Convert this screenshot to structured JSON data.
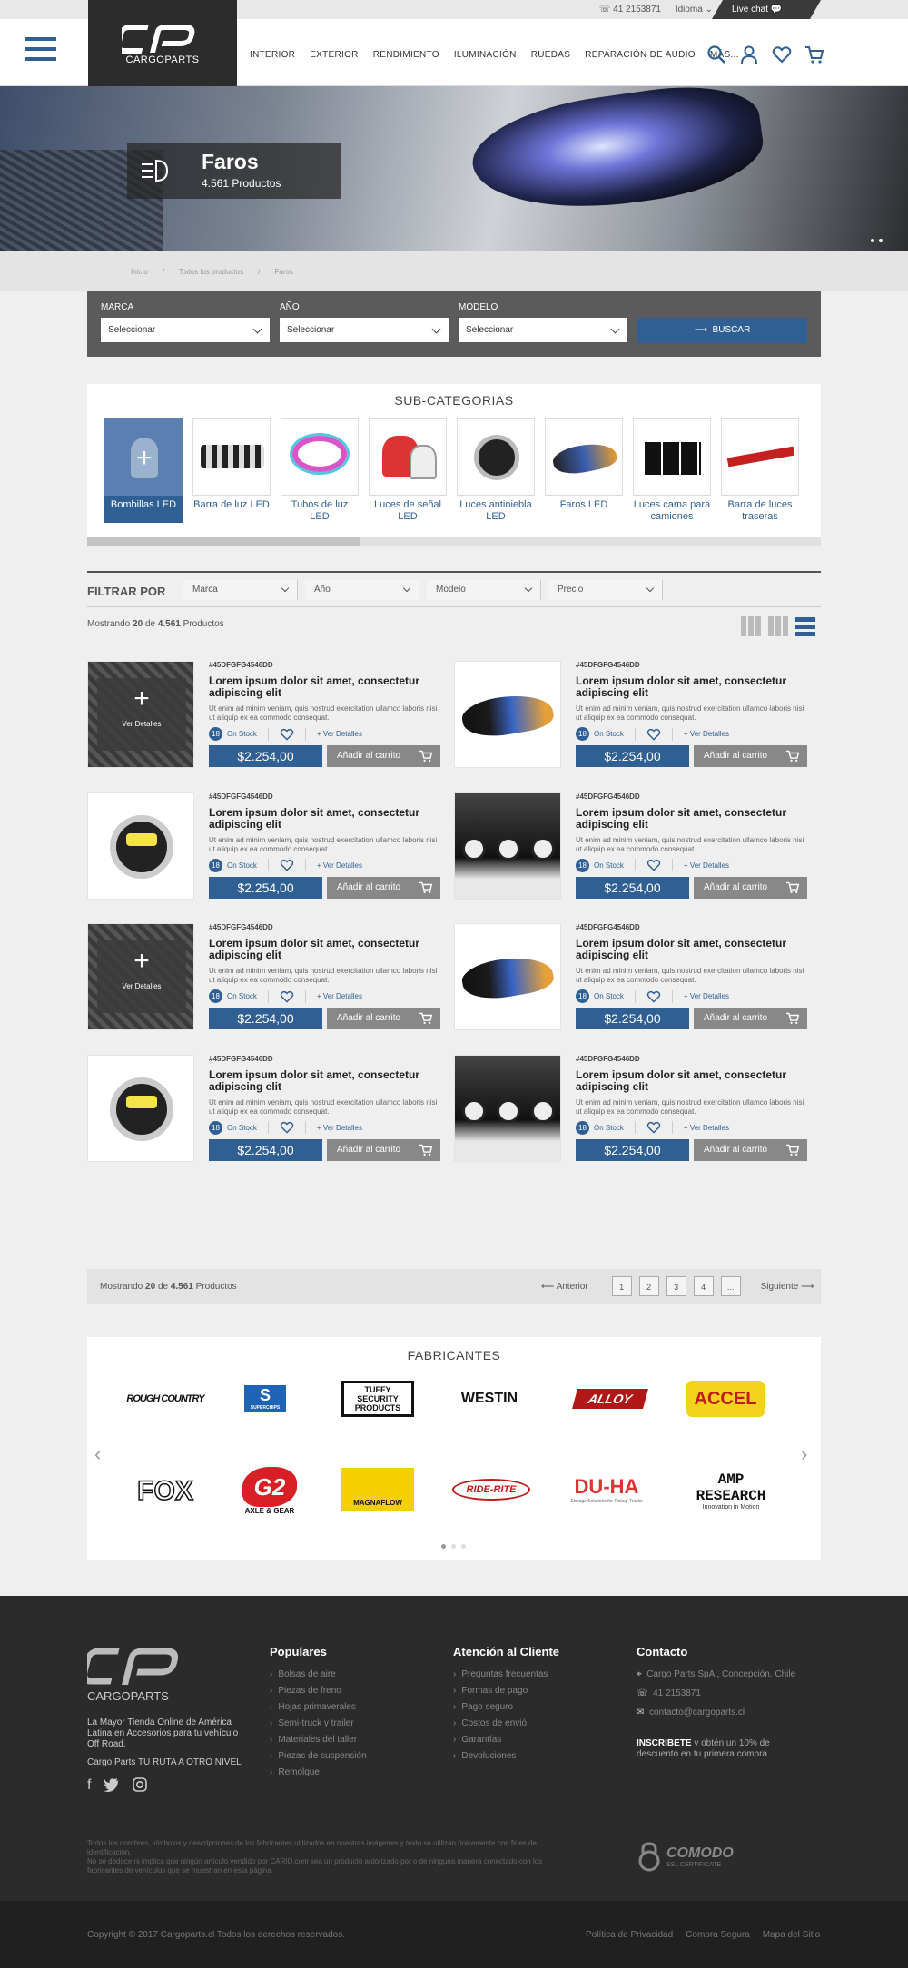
{
  "topbar": {
    "phone": "41 2153871",
    "language": "Idioma",
    "livechat": "Live chat"
  },
  "brand": {
    "name": "CARGOPARTS",
    "mark": "CP"
  },
  "nav": [
    "INTERIOR",
    "EXTERIOR",
    "RENDIMIENTO",
    "ILUMINACIÓN",
    "RUEDAS",
    "REPARACIÓN DE AUDIO",
    "MÁS..."
  ],
  "hero": {
    "title": "Faros",
    "count": "4.561 Productos"
  },
  "breadcrumb": [
    "Inicio",
    "Todos los productos",
    "Faros"
  ],
  "search": {
    "fields": [
      {
        "label": "MARCA",
        "value": "Seleccionar"
      },
      {
        "label": "AÑO",
        "value": "Seleccionar"
      },
      {
        "label": "MODELO",
        "value": "Seleccionar"
      }
    ],
    "button": "BUSCAR"
  },
  "subcategories": {
    "title": "SUB-CATEGORIAS",
    "items": [
      "Bombillas LED",
      "Barra de luz LED",
      "Tubos de luz LED",
      "Luces de señal LED",
      "Luces antiniebla LED",
      "Faros LED",
      "Luces cama para camiones",
      "Barra de luces traseras"
    ]
  },
  "filter": {
    "title": "FILTRAR POR",
    "options": [
      "Marca",
      "Año",
      "Modelo",
      "Precio"
    ]
  },
  "showing": {
    "prefix": "Mostrando",
    "shown": "20",
    "of": "de",
    "total": "4.561",
    "suffix": "Productos"
  },
  "products": [
    {
      "sku": "#45DFGFG4546DD",
      "title": "Lorem ipsum dolor sit amet, consectetur adipiscing elit",
      "desc": "Ut enim ad minim veniam, quis nostrud exercitation ullamco laboris nisi ut aliquip ex ea commodo consequat.",
      "stock_count": "18",
      "stock": "On Stock",
      "details": "Ver Detalles",
      "price": "$2.254,00",
      "cart": "Añadir al carrito",
      "overlay": "Ver Detalles",
      "img": "grille"
    },
    {
      "sku": "#45DFGFG4546DD",
      "title": "Lorem ipsum dolor sit amet, consectetur adipiscing elit",
      "desc": "Ut enim ad minim veniam, quis nostrud exercitation ullamco laboris nisi ut aliquip ex ea commodo consequat.",
      "stock_count": "18",
      "stock": "On Stock",
      "details": "Ver Detalles",
      "price": "$2.254,00",
      "cart": "Añadir al carrito",
      "overlay": "",
      "img": "headlight"
    },
    {
      "sku": "#45DFGFG4546DD",
      "title": "Lorem ipsum dolor sit amet, consectetur adipiscing elit",
      "desc": "Ut enim ad minim veniam, quis nostrud exercitation ullamco laboris nisi ut aliquip ex ea commodo consequat.",
      "stock_count": "18",
      "stock": "On Stock",
      "details": "Ver Detalles",
      "price": "$2.254,00",
      "cart": "Añadir al carrito",
      "overlay": "",
      "img": "foglight"
    },
    {
      "sku": "#45DFGFG4546DD",
      "title": "Lorem ipsum dolor sit amet, consectetur adipiscing elit",
      "desc": "Ut enim ad minim veniam, quis nostrud exercitation ullamco laboris nisi ut aliquip ex ea commodo consequat.",
      "stock_count": "18",
      "stock": "On Stock",
      "details": "Ver Detalles",
      "price": "$2.254,00",
      "cart": "Añadir al carrito",
      "overlay": "",
      "img": "jeep"
    },
    {
      "sku": "#45DFGFG4546DD",
      "title": "Lorem ipsum dolor sit amet, consectetur adipiscing elit",
      "desc": "Ut enim ad minim veniam, quis nostrud exercitation ullamco laboris nisi ut aliquip ex ea commodo consequat.",
      "stock_count": "18",
      "stock": "On Stock",
      "details": "Ver Detalles",
      "price": "$2.254,00",
      "cart": "Añadir al carrito",
      "overlay": "Ver Detalles",
      "img": "grille"
    },
    {
      "sku": "#45DFGFG4546DD",
      "title": "Lorem ipsum dolor sit amet, consectetur adipiscing elit",
      "desc": "Ut enim ad minim veniam, quis nostrud exercitation ullamco laboris nisi ut aliquip ex ea commodo consequat.",
      "stock_count": "18",
      "stock": "On Stock",
      "details": "Ver Detalles",
      "price": "$2.254,00",
      "cart": "Añadir al carrito",
      "overlay": "",
      "img": "headlight"
    },
    {
      "sku": "#45DFGFG4546DD",
      "title": "Lorem ipsum dolor sit amet, consectetur adipiscing elit",
      "desc": "Ut enim ad minim veniam, quis nostrud exercitation ullamco laboris nisi ut aliquip ex ea commodo consequat.",
      "stock_count": "18",
      "stock": "On Stock",
      "details": "Ver Detalles",
      "price": "$2.254,00",
      "cart": "Añadir al carrito",
      "overlay": "",
      "img": "foglight"
    },
    {
      "sku": "#45DFGFG4546DD",
      "title": "Lorem ipsum dolor sit amet, consectetur adipiscing elit",
      "desc": "Ut enim ad minim veniam, quis nostrud exercitation ullamco laboris nisi ut aliquip ex ea commodo consequat.",
      "stock_count": "18",
      "stock": "On Stock",
      "details": "Ver Detalles",
      "price": "$2.254,00",
      "cart": "Añadir al carrito",
      "overlay": "",
      "img": "jeep"
    }
  ],
  "pager": {
    "prev": "Anterior",
    "pages": [
      "1",
      "2",
      "3",
      "4",
      "..."
    ],
    "next": "Siguiente"
  },
  "manufacturers": {
    "title": "FABRICANTES",
    "brands": [
      "ROUGH COUNTRY",
      "SUPERCHIPS",
      "TUFFY SECURITY PRODUCTS",
      "WESTIN",
      "ALLOY",
      "ACCEL",
      "FOX",
      "G2 AXLE & GEAR",
      "MAGNAFLOW",
      "RIDE-RITE",
      "DU-HA",
      "AMP RESEARCH"
    ],
    "brand_sublines": {
      "superchips": "SUPERCHIPS",
      "g2": "AXLE & GEAR",
      "duha": "Storage Solutions for Pickup Trucks",
      "amp": "Innovation in Motion"
    }
  },
  "footer": {
    "tagline": "La Mayor Tienda Online de América Latina en Accesorios para tu vehículo Off Road.",
    "slogan": "Cargo Parts TU RUTA A OTRO NIVEL",
    "col1": {
      "title": "Populares",
      "items": [
        "Bolsas de aire",
        "Piezas de freno",
        "Hojas primaverales",
        "Semi-truck y trailer",
        "Materiales del taller",
        "Piezas de suspensión",
        "Remolque"
      ]
    },
    "col2": {
      "title": "Atención al Cliente",
      "items": [
        "Preguntas frecuentas",
        "Formas de pago",
        "Pago seguro",
        "Costos de envió",
        "Garantías",
        "Devoluciones"
      ]
    },
    "contact": {
      "title": "Contacto",
      "address": "Cargo Parts SpA , Concepción. Chile",
      "phone": "41 2153871",
      "email": "contacto@cargoparts.cl",
      "subscribe_bold": "INSCRIBETE",
      "subscribe_text": " y obtén un 10% de descuento en tu primera compra."
    },
    "legal1": "Todos los nombres, símbolos y descripciones de los fabricantes utilizados en nuestras imágenes y texto se utilizan únicamente con fines de identificación.",
    "legal2": "No se deduce ni implica que ningún artículo vendido por CARID.com sea un producto autorizado por o de ninguna manera conectado con los fabricantes de vehículos que se muestran en esta página.",
    "comodo": "COMODO",
    "comodo_sub": "SSL CERTIFICATE"
  },
  "bottom": {
    "copyright": "Copyright © 2017 Cargoparts.cl  Todos los derechos reservados.",
    "links": [
      "Política de Privacidad",
      "Compra Segura",
      "Mapa del Sitio"
    ]
  },
  "colors": {
    "accent": "#2f5f93",
    "dark": "#2b2b2b",
    "gray": "#888888"
  }
}
